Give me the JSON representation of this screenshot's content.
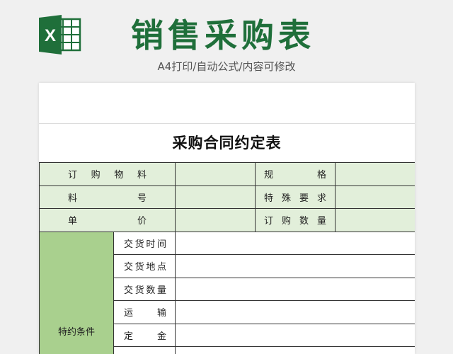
{
  "header": {
    "title": "销售采购表",
    "subtitle": "A4打印/自动公式/内容可修改",
    "logo_icon": "excel-icon",
    "logo_letter": "X",
    "brand_color": "#1f6f3a"
  },
  "sheet": {
    "title": "采购合同约定表",
    "rows": [
      {
        "left": [
          "订",
          "购",
          "物",
          "料"
        ],
        "right": [
          "规",
          "格"
        ]
      },
      {
        "left": [
          "料",
          "号"
        ],
        "right": [
          "特",
          "殊",
          "要",
          "求"
        ]
      },
      {
        "left": [
          "单",
          "价"
        ],
        "right": [
          "订",
          "购",
          "数",
          "量"
        ]
      }
    ],
    "special": {
      "label": "特约条件",
      "items": [
        [
          "交",
          "货",
          "时",
          "间"
        ],
        [
          "交",
          "货",
          "地",
          "点"
        ],
        [
          "交",
          "货",
          "数",
          "量"
        ],
        [
          "运",
          "输"
        ],
        [
          "定",
          "金"
        ]
      ]
    },
    "colors": {
      "light_green": "#e2efda",
      "dark_green": "#a9d08e"
    }
  }
}
